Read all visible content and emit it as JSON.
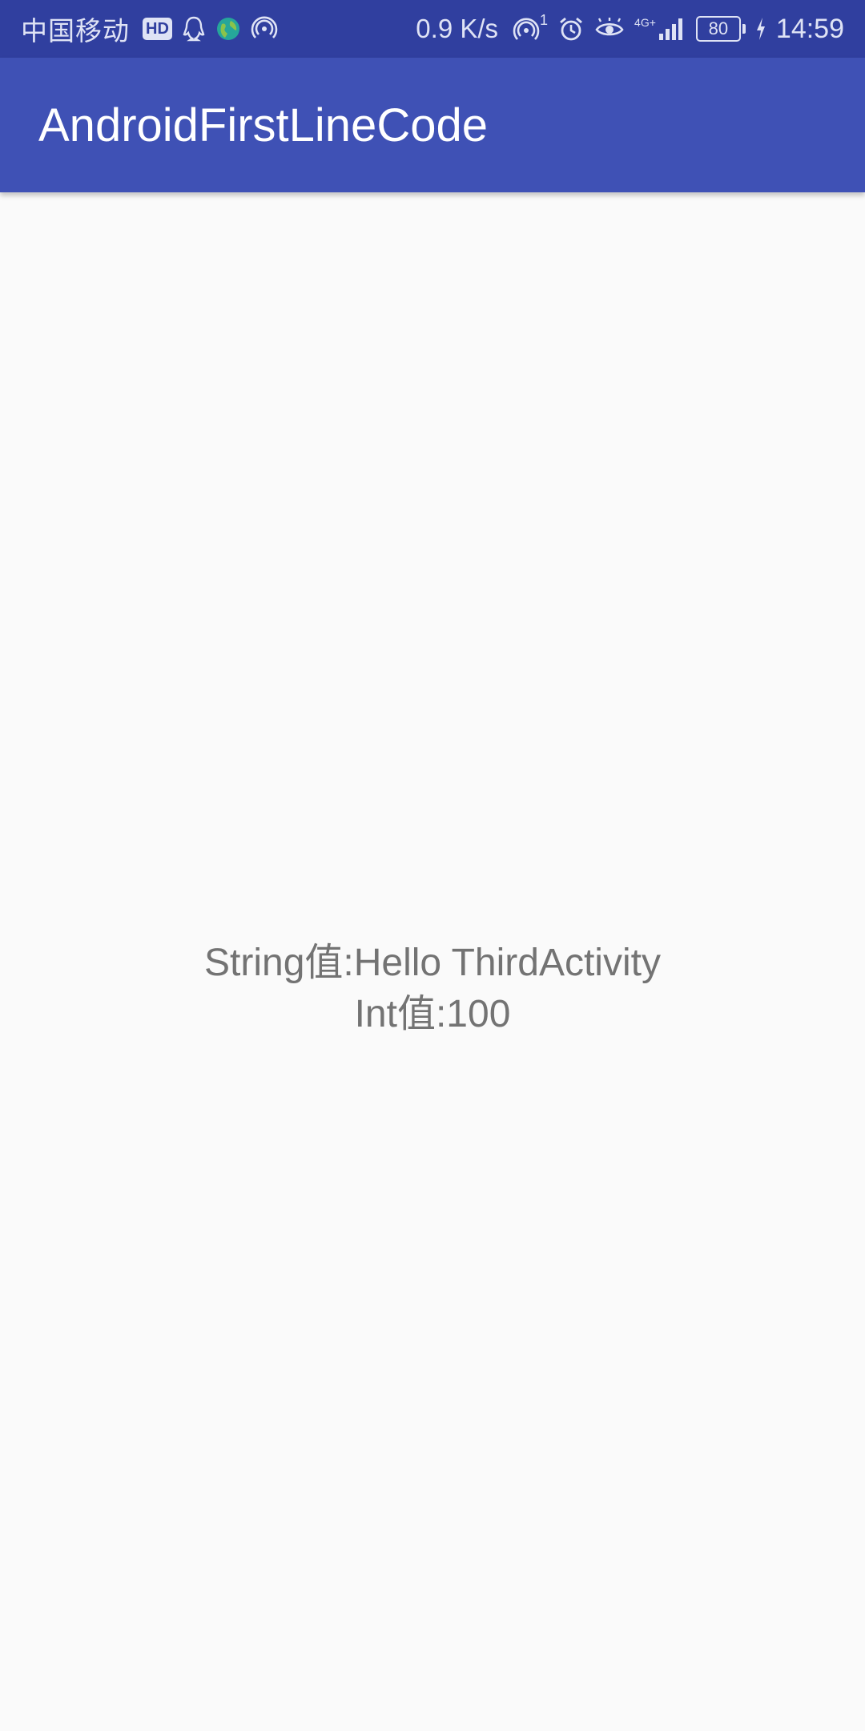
{
  "status_bar": {
    "carrier": "中国移动",
    "hd_badge": "HD",
    "net_speed": "0.9 K/s",
    "hotspot_count": "1",
    "network_type": "4G+",
    "battery_level": "80",
    "time": "14:59",
    "icons": [
      "hd-icon",
      "qq-icon",
      "globe-icon",
      "hotspot-icon",
      "hotspot-active-icon",
      "alarm-icon",
      "eye-icon",
      "signal-icon",
      "battery-icon",
      "charging-icon"
    ]
  },
  "app_bar": {
    "title": "AndroidFirstLineCode"
  },
  "main": {
    "string_line": "String值:Hello ThirdActivity",
    "int_line": "Int值:100"
  },
  "colors": {
    "status_bar": "#303f9f",
    "app_bar": "#3f51b5",
    "background": "#fafafa",
    "text": "#737373"
  }
}
